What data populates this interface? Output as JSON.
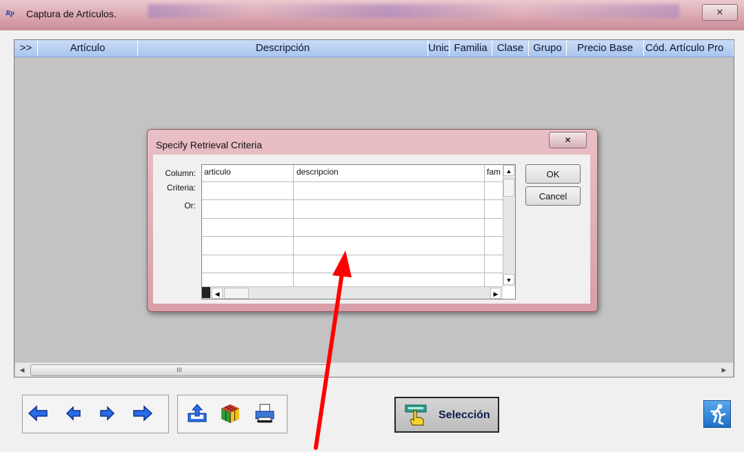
{
  "window": {
    "title": "Captura de Artículos.",
    "close_label": "✕"
  },
  "grid": {
    "columns": [
      ">>",
      "Artículo",
      "Descripción",
      "Unic",
      "Familia",
      "Clase",
      "Grupo",
      "Precio Base",
      "Cód. Artículo Pro"
    ],
    "scroll_thumb_glyph": "III"
  },
  "toolbar": {
    "nav_icons": [
      "first-record-icon",
      "prev-record-icon",
      "next-record-icon",
      "last-record-icon"
    ],
    "tool_icons": [
      "export-icon",
      "rubiks-cube-icon",
      "print-icon"
    ],
    "seleccion_label": "Selección"
  },
  "dialog": {
    "title": "Specify Retrieval Criteria",
    "row_labels": {
      "column": "Column:",
      "criteria": "Criteria:",
      "or": "Or:"
    },
    "columns": [
      "articulo",
      "descripcion",
      "fam"
    ],
    "ok_label": "OK",
    "cancel_label": "Cancel"
  },
  "annotation": {
    "color": "#ff0000"
  }
}
